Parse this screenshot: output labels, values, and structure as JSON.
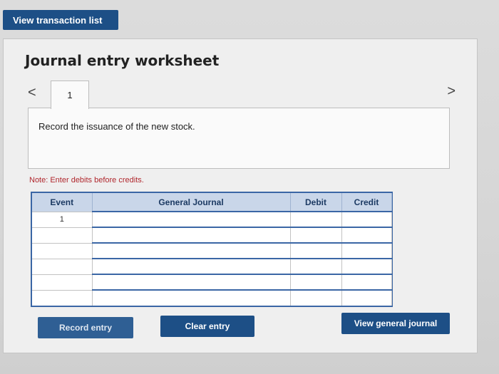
{
  "top": {
    "view_transaction_label": "View transaction list"
  },
  "worksheet": {
    "title": "Journal entry worksheet",
    "nav_prev": "<",
    "nav_next": ">",
    "tabs": [
      {
        "label": "1"
      }
    ],
    "prompt": "Record the issuance of the new stock.",
    "note": "Note: Enter debits before credits."
  },
  "table": {
    "headers": {
      "event": "Event",
      "journal": "General Journal",
      "debit": "Debit",
      "credit": "Credit"
    },
    "rows": [
      {
        "event": "1"
      },
      {
        "event": ""
      },
      {
        "event": ""
      },
      {
        "event": ""
      },
      {
        "event": ""
      },
      {
        "event": ""
      }
    ]
  },
  "buttons": {
    "record": "Record entry",
    "clear": "Clear entry",
    "view_journal": "View general journal"
  },
  "colors": {
    "primary": "#1d4f86",
    "table_header": "#c9d6e9",
    "note": "#b0272d"
  }
}
